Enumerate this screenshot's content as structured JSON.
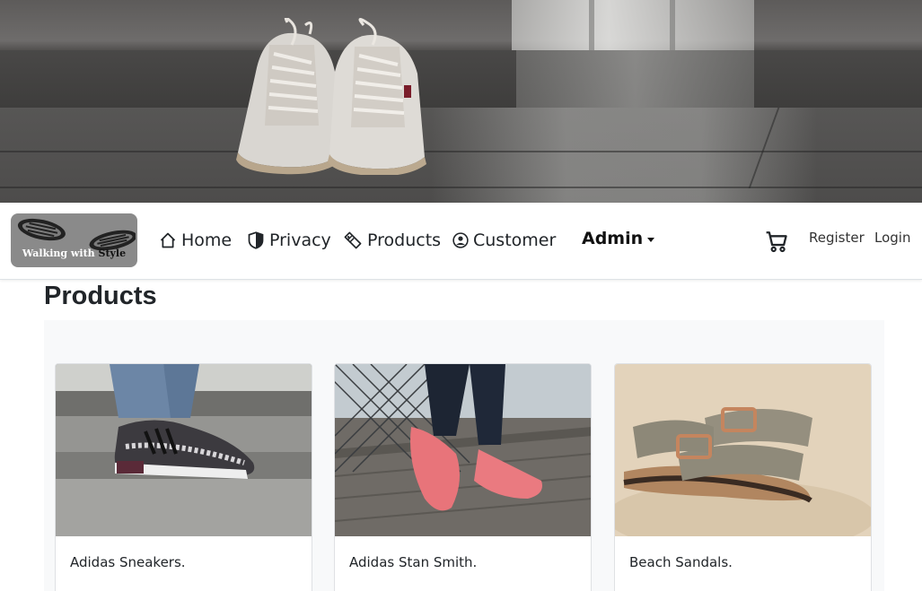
{
  "brand": {
    "logo_alt": "Walking with Style",
    "logo_word1": "Walking with",
    "logo_word2": "Style"
  },
  "nav": {
    "items": [
      {
        "label": "Home",
        "icon": "house-icon"
      },
      {
        "label": "Privacy",
        "icon": "shield-icon"
      },
      {
        "label": "Products",
        "icon": "tag-icon"
      },
      {
        "label": "Customer",
        "icon": "person-circle-icon"
      }
    ],
    "admin_label": "Admin",
    "cart_icon": "cart-icon",
    "register_label": "Register",
    "login_label": "Login"
  },
  "page": {
    "title": "Products"
  },
  "products": [
    {
      "name": "Adidas Sneakers."
    },
    {
      "name": "Adidas Stan Smith."
    },
    {
      "name": "Beach Sandals."
    }
  ],
  "colors": {
    "panel_bg": "#f8f9fa",
    "logo_bg": "#8a8a8a",
    "text": "#212529"
  }
}
